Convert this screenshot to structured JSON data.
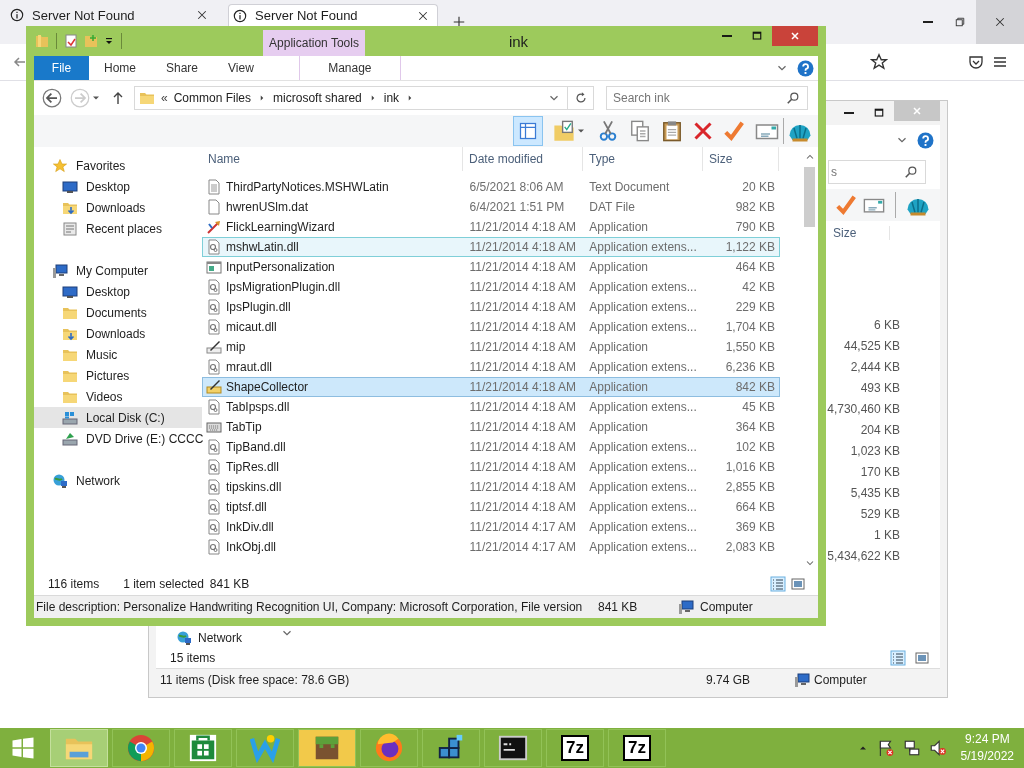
{
  "browser": {
    "tabs": [
      {
        "title": "Server Not Found",
        "selected": false
      },
      {
        "title": "Server Not Found",
        "selected": true
      }
    ]
  },
  "back_window": {
    "search_placeholder": "s",
    "columns": [
      "Size"
    ],
    "sizes": [
      "6 KB",
      "44,525 KB",
      "2,444 KB",
      "493 KB",
      "4,730,460 KB",
      "204 KB",
      "1,023 KB",
      "170 KB",
      "5,435 KB",
      "529 KB",
      "1 KB",
      "5,434,622 KB"
    ],
    "nav": [
      {
        "label": "Network",
        "kind": "network"
      }
    ],
    "item_count": "15 items",
    "status_bar": {
      "summary": "11 items (Disk free space: 78.6 GB)",
      "size": "9.74 GB",
      "location": "Computer"
    }
  },
  "window": {
    "title": "ink",
    "contextual_tab": "Application Tools",
    "ribbon_tabs": [
      {
        "label": "File",
        "kind": "file"
      },
      {
        "label": "Home",
        "kind": "tab"
      },
      {
        "label": "Share",
        "kind": "tab"
      },
      {
        "label": "View",
        "kind": "tab"
      },
      {
        "label": "Manage",
        "kind": "contextual"
      }
    ],
    "address": {
      "overflow": "«",
      "crumbs": [
        "Common Files",
        "microsoft shared",
        "ink"
      ],
      "search_placeholder": "Search ink"
    },
    "nav": [
      {
        "label": "Favorites",
        "kind": "star",
        "selected": false,
        "children": [
          {
            "label": "Desktop",
            "kind": "desktop",
            "selected": false
          },
          {
            "label": "Downloads",
            "kind": "downloads",
            "selected": false
          },
          {
            "label": "Recent places",
            "kind": "recent",
            "selected": false
          }
        ]
      },
      {
        "label": "My Computer",
        "kind": "computer",
        "selected": false,
        "children": [
          {
            "label": "Desktop",
            "kind": "desktop",
            "selected": false
          },
          {
            "label": "Documents",
            "kind": "folder",
            "selected": false
          },
          {
            "label": "Downloads",
            "kind": "downloads",
            "selected": false
          },
          {
            "label": "Music",
            "kind": "folder",
            "selected": false
          },
          {
            "label": "Pictures",
            "kind": "folder",
            "selected": false
          },
          {
            "label": "Videos",
            "kind": "folder",
            "selected": false
          },
          {
            "label": "Local Disk (C:)",
            "kind": "drive",
            "selected": true
          },
          {
            "label": "DVD Drive (E:) CCCC",
            "kind": "dvd",
            "selected": false
          }
        ]
      },
      {
        "label": "Network",
        "kind": "network",
        "selected": false
      }
    ],
    "columns": [
      "Name",
      "Date modified",
      "Type",
      "Size"
    ],
    "rows": [
      {
        "name": "ThirdPartyNotices.MSHWLatin",
        "date": "6/5/2021 8:06 AM",
        "type": "Text Document",
        "size": "20 KB",
        "kind": "text",
        "selected": false,
        "hovered": false
      },
      {
        "name": "hwrenUSlm.dat",
        "date": "6/4/2021 1:51 PM",
        "type": "DAT File",
        "size": "982 KB",
        "kind": "file",
        "selected": false,
        "hovered": false
      },
      {
        "name": "FlickLearningWizard",
        "date": "11/21/2014 4:18 AM",
        "type": "Application",
        "size": "790 KB",
        "kind": "wizard",
        "selected": false,
        "hovered": false
      },
      {
        "name": "mshwLatin.dll",
        "date": "11/21/2014 4:18 AM",
        "type": "Application extens...",
        "size": "1,122 KB",
        "kind": "dll",
        "selected": false,
        "hovered": true
      },
      {
        "name": "InputPersonalization",
        "date": "11/21/2014 4:18 AM",
        "type": "Application",
        "size": "464 KB",
        "kind": "window",
        "selected": false,
        "hovered": false
      },
      {
        "name": "IpsMigrationPlugin.dll",
        "date": "11/21/2014 4:18 AM",
        "type": "Application extens...",
        "size": "42 KB",
        "kind": "dll",
        "selected": false,
        "hovered": false
      },
      {
        "name": "IpsPlugin.dll",
        "date": "11/21/2014 4:18 AM",
        "type": "Application extens...",
        "size": "229 KB",
        "kind": "dll",
        "selected": false,
        "hovered": false
      },
      {
        "name": "micaut.dll",
        "date": "11/21/2014 4:18 AM",
        "type": "Application extens...",
        "size": "1,704 KB",
        "kind": "dll",
        "selected": false,
        "hovered": false
      },
      {
        "name": "mip",
        "date": "11/21/2014 4:18 AM",
        "type": "Application",
        "size": "1,550 KB",
        "kind": "pen",
        "selected": false,
        "hovered": false
      },
      {
        "name": "mraut.dll",
        "date": "11/21/2014 4:18 AM",
        "type": "Application extens...",
        "size": "6,236 KB",
        "kind": "dll",
        "selected": false,
        "hovered": false
      },
      {
        "name": "ShapeCollector",
        "date": "11/21/2014 4:18 AM",
        "type": "Application",
        "size": "842 KB",
        "kind": "shape",
        "selected": true,
        "hovered": false
      },
      {
        "name": "TabIpsps.dll",
        "date": "11/21/2014 4:18 AM",
        "type": "Application extens...",
        "size": "45 KB",
        "kind": "dll",
        "selected": false,
        "hovered": false
      },
      {
        "name": "TabTip",
        "date": "11/21/2014 4:18 AM",
        "type": "Application",
        "size": "364 KB",
        "kind": "keyboard",
        "selected": false,
        "hovered": false
      },
      {
        "name": "TipBand.dll",
        "date": "11/21/2014 4:18 AM",
        "type": "Application extens...",
        "size": "102 KB",
        "kind": "dll",
        "selected": false,
        "hovered": false
      },
      {
        "name": "TipRes.dll",
        "date": "11/21/2014 4:18 AM",
        "type": "Application extens...",
        "size": "1,016 KB",
        "kind": "dll",
        "selected": false,
        "hovered": false
      },
      {
        "name": "tipskins.dll",
        "date": "11/21/2014 4:18 AM",
        "type": "Application extens...",
        "size": "2,855 KB",
        "kind": "dll",
        "selected": false,
        "hovered": false
      },
      {
        "name": "tiptsf.dll",
        "date": "11/21/2014 4:18 AM",
        "type": "Application extens...",
        "size": "664 KB",
        "kind": "dll",
        "selected": false,
        "hovered": false
      },
      {
        "name": "InkDiv.dll",
        "date": "11/21/2014 4:17 AM",
        "type": "Application extens...",
        "size": "369 KB",
        "kind": "dll",
        "selected": false,
        "hovered": false
      },
      {
        "name": "InkObj.dll",
        "date": "11/21/2014 4:17 AM",
        "type": "Application extens...",
        "size": "2,083 KB",
        "kind": "dll",
        "selected": false,
        "hovered": false
      }
    ],
    "item_count": "116 items",
    "selection": "1 item selected",
    "selection_size": "841 KB",
    "details": {
      "description": "File description: Personalize Handwriting Recognition UI, Company: Microsoft Corporation, File version",
      "size": "841 KB",
      "location": "Computer"
    }
  },
  "taskbar": {
    "apps": [
      {
        "kind": "explorer",
        "selected": true,
        "flashing": false
      },
      {
        "kind": "chrome",
        "selected": false,
        "flashing": false
      },
      {
        "kind": "store",
        "selected": false,
        "flashing": false
      },
      {
        "kind": "w-app",
        "selected": false,
        "flashing": false
      },
      {
        "kind": "minecraft",
        "selected": false,
        "flashing": true
      },
      {
        "kind": "firefox",
        "selected": false,
        "flashing": false
      },
      {
        "kind": "cubes",
        "selected": false,
        "flashing": false
      },
      {
        "kind": "terminal",
        "selected": false,
        "flashing": false
      },
      {
        "kind": "sevenzip",
        "label": "7z",
        "selected": false,
        "flashing": false
      },
      {
        "kind": "sevenzip",
        "label": "7z",
        "selected": false,
        "flashing": false
      }
    ],
    "clock": {
      "time": "9:24 PM",
      "date": "5/19/2022"
    }
  }
}
